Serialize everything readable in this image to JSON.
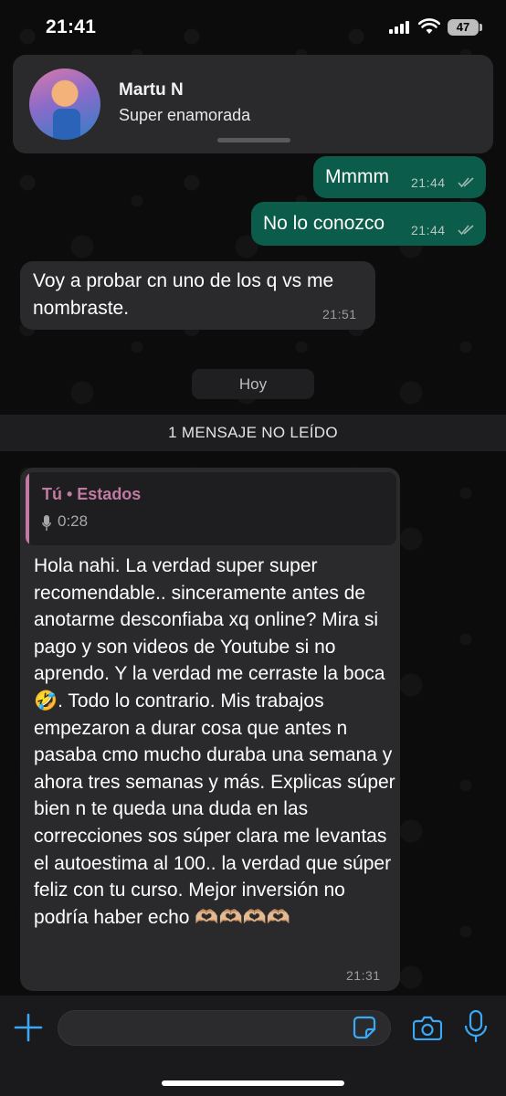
{
  "status_bar": {
    "time": "21:41",
    "battery": "47"
  },
  "notification": {
    "sender": "Martu N",
    "message": "Super enamorada"
  },
  "messages": [
    {
      "text": "Mmmm",
      "time": "21:44"
    },
    {
      "text": "No lo conozco",
      "time": "21:44"
    },
    {
      "text": "Voy a probar cn uno de los q vs me nombraste.",
      "time": "21:51"
    }
  ],
  "date_separator": "Hoy",
  "unread_banner": "1 MENSAJE NO LEÍDO",
  "reply_message": {
    "quote_title": "Tú • Estados",
    "quote_duration": "0:28",
    "text": "Hola nahi. La verdad super super recomendable.. sinceramente antes de anotarme desconfiaba xq online? Mira si pago y son videos de Youtube si no aprendo. Y la verdad me cerraste la boca 🤣. Todo lo contrario. Mis trabajos empezaron a durar cosa que antes n pasaba cmo mucho duraba una semana y ahora tres semanas y más. Explicas súper bien n te queda una duda en las correcciones sos súper clara me levantas el autoestima al 100.. la verdad que súper feliz con tu curso. Mejor inversión no podría haber echo 🫶🏼🫶🏼🫶🏼🫶🏼",
    "time": "21:31"
  },
  "colors": {
    "outgoing": "#0b5c4b",
    "incoming": "#2a2a2c",
    "accent": "#3ba8f5",
    "quote": "#c27aa3"
  },
  "icons": [
    "plus-icon",
    "sticker-icon",
    "camera-icon",
    "microphone-icon",
    "double-check-icon"
  ]
}
